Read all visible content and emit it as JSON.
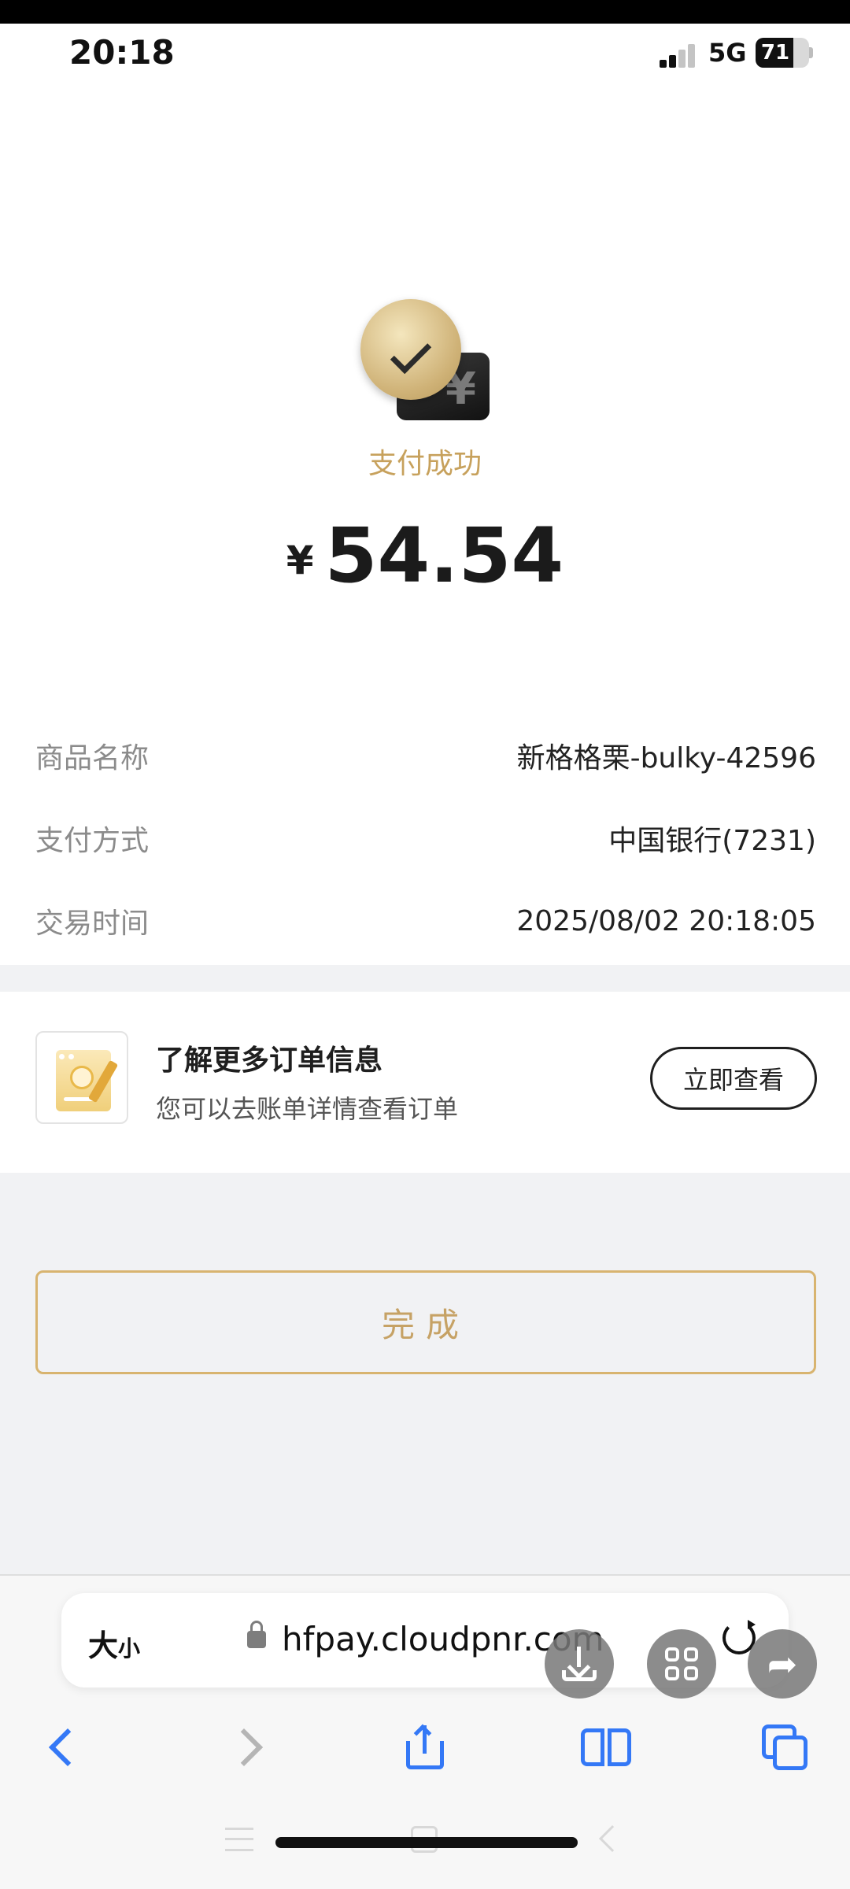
{
  "status_bar": {
    "time": "20:18",
    "network": "5G",
    "battery": "71",
    "battery_level": 0.71,
    "signal_bars_filled": 2,
    "signal_bars_total": 4
  },
  "payment": {
    "status_text": "支付成功",
    "currency_symbol": "¥",
    "amount": "54.54",
    "icon_glyph": "¥"
  },
  "details": [
    {
      "label": "商品名称",
      "value": "新格格栗-bulky-42596"
    },
    {
      "label": "支付方式",
      "value": "中国银行(7231)"
    },
    {
      "label": "交易时间",
      "value": "2025/08/02 20:18:05"
    }
  ],
  "order_info": {
    "title": "了解更多订单信息",
    "subtitle": "您可以去账单详情查看订单",
    "button_label": "立即查看"
  },
  "done_button_label": "完成",
  "browser": {
    "text_size_big": "大",
    "text_size_small": "小",
    "url": "hfpay.cloudpnr.com",
    "share_glyph": "➦"
  },
  "colors": {
    "accent_gold": "#c6a265",
    "ios_blue": "#3478f6",
    "amount_text": "#1b1b1b"
  },
  "icons": {
    "success": "gold-check-circle-with-yuan-card-icon",
    "order": "document-check-pen-icon",
    "download": "download-icon",
    "grid": "grid-icon",
    "share": "share-arrow-icon"
  }
}
